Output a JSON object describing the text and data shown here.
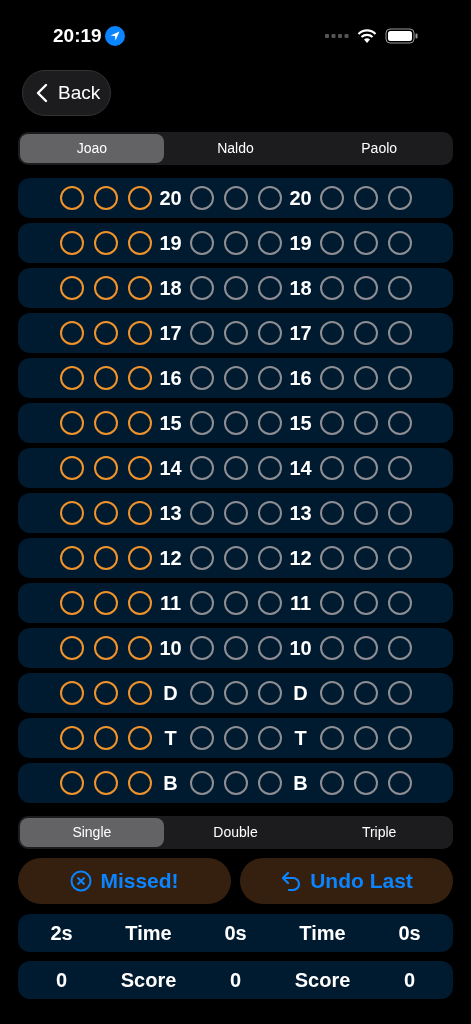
{
  "status_bar": {
    "time": "20:19"
  },
  "back_button": {
    "label": "Back"
  },
  "players": [
    {
      "label": "Joao",
      "selected": true
    },
    {
      "label": "Naldo",
      "selected": false
    },
    {
      "label": "Paolo",
      "selected": false
    }
  ],
  "board": [
    {
      "labels": [
        "20",
        "20"
      ],
      "groups": [
        {
          "active": true
        },
        {
          "active": false
        },
        {
          "active": false
        }
      ]
    },
    {
      "labels": [
        "19",
        "19"
      ],
      "groups": [
        {
          "active": true
        },
        {
          "active": false
        },
        {
          "active": false
        }
      ]
    },
    {
      "labels": [
        "18",
        "18"
      ],
      "groups": [
        {
          "active": true
        },
        {
          "active": false
        },
        {
          "active": false
        }
      ]
    },
    {
      "labels": [
        "17",
        "17"
      ],
      "groups": [
        {
          "active": true
        },
        {
          "active": false
        },
        {
          "active": false
        }
      ]
    },
    {
      "labels": [
        "16",
        "16"
      ],
      "groups": [
        {
          "active": true
        },
        {
          "active": false
        },
        {
          "active": false
        }
      ]
    },
    {
      "labels": [
        "15",
        "15"
      ],
      "groups": [
        {
          "active": true
        },
        {
          "active": false
        },
        {
          "active": false
        }
      ]
    },
    {
      "labels": [
        "14",
        "14"
      ],
      "groups": [
        {
          "active": true
        },
        {
          "active": false
        },
        {
          "active": false
        }
      ]
    },
    {
      "labels": [
        "13",
        "13"
      ],
      "groups": [
        {
          "active": true
        },
        {
          "active": false
        },
        {
          "active": false
        }
      ]
    },
    {
      "labels": [
        "12",
        "12"
      ],
      "groups": [
        {
          "active": true
        },
        {
          "active": false
        },
        {
          "active": false
        }
      ]
    },
    {
      "labels": [
        "11",
        "11"
      ],
      "groups": [
        {
          "active": true
        },
        {
          "active": false
        },
        {
          "active": false
        }
      ]
    },
    {
      "labels": [
        "10",
        "10"
      ],
      "groups": [
        {
          "active": true
        },
        {
          "active": false
        },
        {
          "active": false
        }
      ]
    },
    {
      "labels": [
        "D",
        "D"
      ],
      "groups": [
        {
          "active": true
        },
        {
          "active": false
        },
        {
          "active": false
        }
      ]
    },
    {
      "labels": [
        "T",
        "T"
      ],
      "groups": [
        {
          "active": true
        },
        {
          "active": false
        },
        {
          "active": false
        }
      ]
    },
    {
      "labels": [
        "B",
        "B"
      ],
      "groups": [
        {
          "active": true
        },
        {
          "active": false
        },
        {
          "active": false
        }
      ]
    }
  ],
  "multiplier": [
    {
      "label": "Single",
      "selected": true
    },
    {
      "label": "Double",
      "selected": false
    },
    {
      "label": "Triple",
      "selected": false
    }
  ],
  "actions": [
    {
      "kind": "missed",
      "label": "Missed!"
    },
    {
      "kind": "undo",
      "label": "Undo Last"
    }
  ],
  "stats": [
    {
      "cells": [
        "2s",
        "Time",
        "0s",
        "Time",
        "0s"
      ]
    },
    {
      "cells": [
        "0",
        "Score",
        "0",
        "Score",
        "0"
      ]
    }
  ]
}
